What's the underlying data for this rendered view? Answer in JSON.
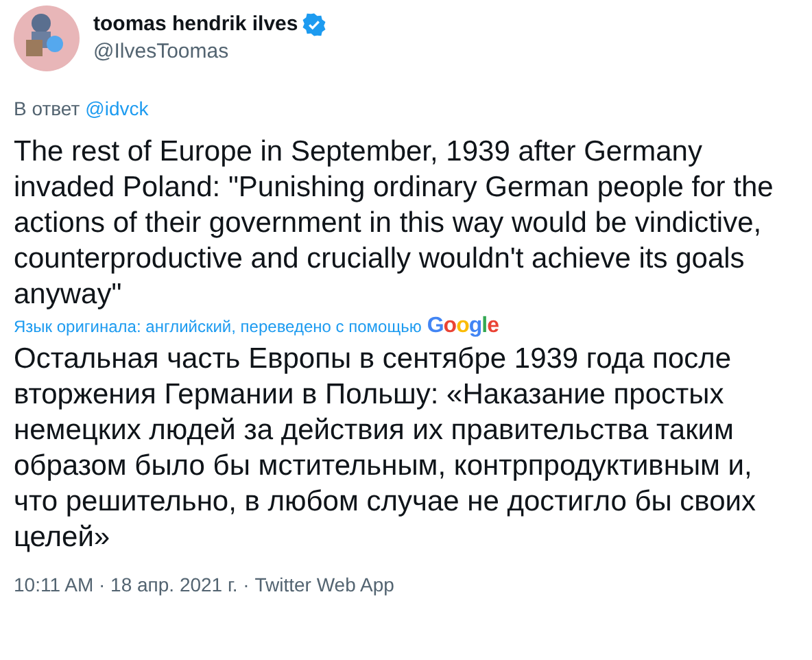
{
  "author": {
    "name": "toomas hendrik ilves",
    "verified": true,
    "handle": "@IlvesToomas"
  },
  "reply_to": {
    "prefix": "В ответ",
    "mention": "@idvck"
  },
  "text": "The rest of Europe in September, 1939 after Germany invaded Poland: \"Punishing ordinary German people for the actions of their government in this way would be vindictive, counterproductive and crucially wouldn't achieve its goals anyway\"",
  "translation_note": {
    "label": "Язык оригинала: английский, переведено с помощью",
    "logo": "Google"
  },
  "translated_text": "Остальная часть Европы в сентябре 1939 года после вторжения Германии в Польшу: «Наказание простых немецких людей за действия их правительства таким образом было бы мстительным, контрпродуктивным и, что решительно, в любом случае не достигло бы своих целей»",
  "footer": "10:11 AM · 18 апр. 2021 г. · Twitter Web App"
}
